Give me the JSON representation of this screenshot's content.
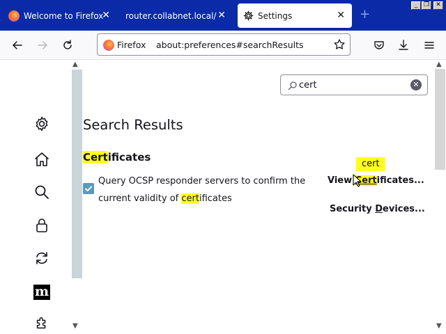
{
  "tabs": [
    {
      "label": "Welcome to Firefox",
      "favicon": "firefox-icon",
      "active": false
    },
    {
      "label": "router.collabnet.local/",
      "favicon": "none",
      "active": false
    },
    {
      "label": "Settings",
      "favicon": "gear-icon",
      "active": true
    }
  ],
  "tab_close": "✕",
  "new_tab": "+",
  "window_controls": {
    "minimize": "_",
    "restore": "❐",
    "close": "✕"
  },
  "toolbar": {
    "identity_label": "Firefox",
    "url": "about:preferences#searchResults"
  },
  "search": {
    "value": "cert",
    "placeholder": ""
  },
  "results": {
    "title": "Search Results",
    "section": {
      "title_highlight": "Cert",
      "title_rest": "ificates"
    },
    "ocsp": {
      "checked": true,
      "text_before": "Query OCSP responder servers to confirm the current validity of ",
      "text_highlight": "cert",
      "text_after": "ificates"
    },
    "tooltip": "cert",
    "view_button": {
      "before": "View ",
      "highlight": "Cert",
      "after": "ificates..."
    },
    "security_button": {
      "before": "Security ",
      "underline": "D",
      "after": "evices..."
    }
  },
  "nav_icons": [
    "gear-icon",
    "home-icon",
    "search-icon",
    "lock-icon",
    "sync-icon",
    "mozilla-m-icon",
    "extensions-icon"
  ],
  "mozilla_glyph": "m",
  "colors": {
    "tabstrip": "#0b2aa8",
    "highlight": "#ffff1f",
    "checkbox": "#5a9bb7"
  }
}
